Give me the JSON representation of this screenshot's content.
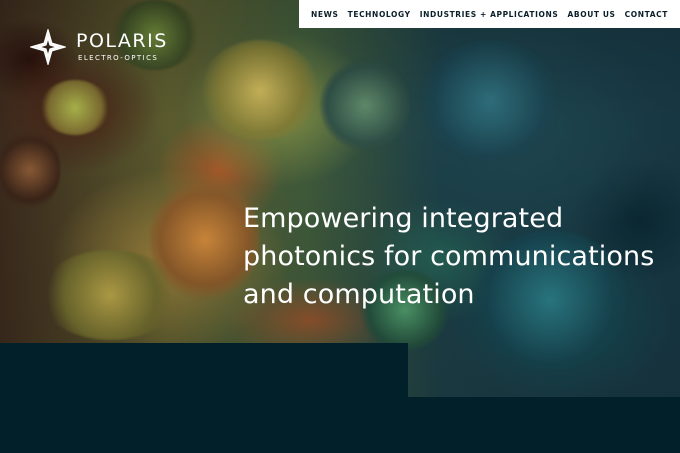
{
  "brand": {
    "name": "POLARIS",
    "tagline": "ELECTRO-OPTICS"
  },
  "nav": {
    "items": [
      {
        "label": "NEWS"
      },
      {
        "label": "TECHNOLOGY"
      },
      {
        "label": "INDUSTRIES + APPLICATIONS"
      },
      {
        "label": "ABOUT US"
      },
      {
        "label": "CONTACT"
      }
    ]
  },
  "hero": {
    "headline": "Empowering integrated photonics for communications and computation"
  },
  "colors": {
    "background_dark": "#02202a",
    "nav_background": "#ffffff",
    "nav_text": "#0b1f2a",
    "headline_text": "#ffffff"
  }
}
